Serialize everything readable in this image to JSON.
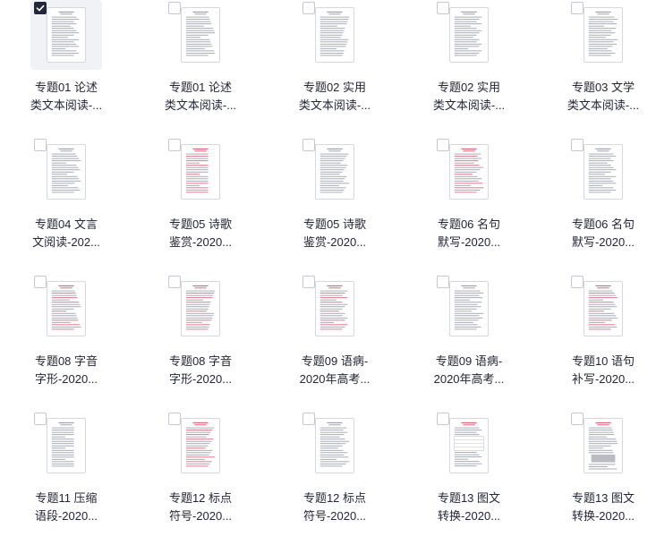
{
  "files": [
    {
      "line1": "专题01 论述",
      "line2": "类文本阅读-...",
      "selected": true,
      "thumb": "plain"
    },
    {
      "line1": "专题01 论述",
      "line2": "类文本阅读-...",
      "selected": false,
      "thumb": "plain"
    },
    {
      "line1": "专题02 实用",
      "line2": "类文本阅读-...",
      "selected": false,
      "thumb": "plain"
    },
    {
      "line1": "专题02 实用",
      "line2": "类文本阅读-...",
      "selected": false,
      "thumb": "plain"
    },
    {
      "line1": "专题03 文学",
      "line2": "类文本阅读-...",
      "selected": false,
      "thumb": "plain"
    },
    {
      "line1": "专题04 文言",
      "line2": "文阅读-202...",
      "selected": false,
      "thumb": "plain"
    },
    {
      "line1": "专题05 诗歌",
      "line2": "鉴赏-2020...",
      "selected": false,
      "thumb": "red"
    },
    {
      "line1": "专题05 诗歌",
      "line2": "鉴赏-2020...",
      "selected": false,
      "thumb": "plain"
    },
    {
      "line1": "专题06 名句",
      "line2": "默写-2020...",
      "selected": false,
      "thumb": "red"
    },
    {
      "line1": "专题06 名句",
      "line2": "默写-2020...",
      "selected": false,
      "thumb": "plain"
    },
    {
      "line1": "专题08 字音",
      "line2": "字形-2020...",
      "selected": false,
      "thumb": "red"
    },
    {
      "line1": "专题08 字音",
      "line2": "字形-2020...",
      "selected": false,
      "thumb": "red"
    },
    {
      "line1": "专题09 语病-",
      "line2": "2020年高考...",
      "selected": false,
      "thumb": "red"
    },
    {
      "line1": "专题09 语病-",
      "line2": "2020年高考...",
      "selected": false,
      "thumb": "plain"
    },
    {
      "line1": "专题10 语句",
      "line2": "补写-2020...",
      "selected": false,
      "thumb": "red"
    },
    {
      "line1": "专题11 压缩",
      "line2": "语段-2020...",
      "selected": false,
      "thumb": "plain"
    },
    {
      "line1": "专题12 标点",
      "line2": "符号-2020...",
      "selected": false,
      "thumb": "red"
    },
    {
      "line1": "专题12 标点",
      "line2": "符号-2020...",
      "selected": false,
      "thumb": "plain"
    },
    {
      "line1": "专题13 图文",
      "line2": "转换-2020...",
      "selected": false,
      "thumb": "table"
    },
    {
      "line1": "专题13 图文",
      "line2": "转换-2020...",
      "selected": false,
      "thumb": "image"
    }
  ],
  "colors": {
    "checkbox_checked": "#22273a",
    "selected_tile_bg": "#f1f2f5",
    "thumb_red_text": "#e0637a",
    "thumb_text": "#9aa0aa",
    "filename_text": "#222533"
  },
  "icons": {
    "checkbox": "checkbox-icon",
    "checkmark": "checkmark-icon",
    "document": "document-thumbnail-icon"
  }
}
